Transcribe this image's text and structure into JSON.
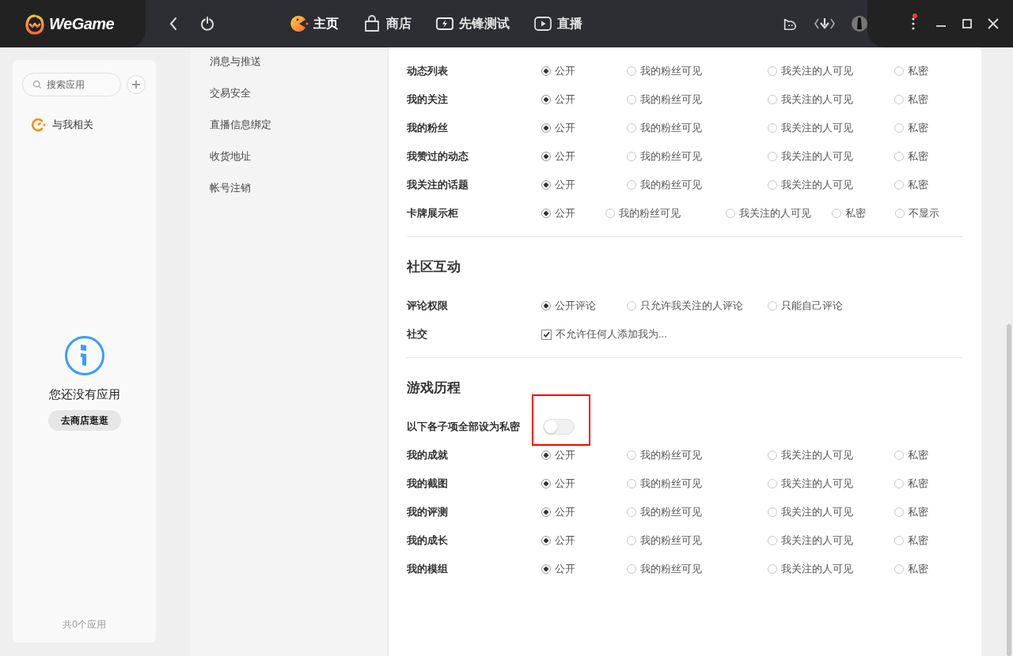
{
  "topbar": {
    "logo": "WeGame",
    "nav": [
      {
        "label": "主页",
        "selected": true
      },
      {
        "label": "商店",
        "selected": false
      },
      {
        "label": "先锋测试",
        "selected": false
      },
      {
        "label": "直播",
        "selected": false
      }
    ],
    "menu_notification": true
  },
  "sidebar": {
    "search": {
      "placeholder": "搜索应用"
    },
    "items": [
      {
        "label": "与我相关"
      }
    ],
    "empty_text": "您还没有应用",
    "store_button": "去商店逛逛",
    "footer": "共0个应用"
  },
  "settings_nav": {
    "items": [
      "消息与推送",
      "交易安全",
      "直播信息绑定",
      "收货地址",
      "帐号注销"
    ]
  },
  "sections": [
    {
      "rows": [
        {
          "label": "动态列表",
          "kind": "radio",
          "options": [
            {
              "label": "公开",
              "selected": true
            },
            {
              "label": "我的粉丝可见",
              "selected": false
            },
            {
              "label": "我关注的人可见",
              "selected": false
            },
            {
              "label": "私密",
              "selected": false
            }
          ]
        },
        {
          "label": "我的关注",
          "kind": "radio",
          "options": [
            {
              "label": "公开",
              "selected": true
            },
            {
              "label": "我的粉丝可见",
              "selected": false
            },
            {
              "label": "我关注的人可见",
              "selected": false
            },
            {
              "label": "私密",
              "selected": false
            }
          ]
        },
        {
          "label": "我的粉丝",
          "kind": "radio",
          "options": [
            {
              "label": "公开",
              "selected": true
            },
            {
              "label": "我的粉丝可见",
              "selected": false
            },
            {
              "label": "我关注的人可见",
              "selected": false
            },
            {
              "label": "私密",
              "selected": false
            }
          ]
        },
        {
          "label": "我赞过的动态",
          "kind": "radio",
          "options": [
            {
              "label": "公开",
              "selected": true
            },
            {
              "label": "我的粉丝可见",
              "selected": false
            },
            {
              "label": "我关注的人可见",
              "selected": false
            },
            {
              "label": "私密",
              "selected": false
            }
          ]
        },
        {
          "label": "我关注的话题",
          "kind": "radio",
          "options": [
            {
              "label": "公开",
              "selected": true
            },
            {
              "label": "我的粉丝可见",
              "selected": false
            },
            {
              "label": "我关注的人可见",
              "selected": false
            },
            {
              "label": "私密",
              "selected": false
            }
          ]
        },
        {
          "label": "卡牌展示柜",
          "kind": "radio",
          "options": [
            {
              "label": "公开",
              "selected": true
            },
            {
              "label": "我的粉丝可见",
              "selected": false
            },
            {
              "label": "我关注的人可见",
              "selected": false
            },
            {
              "label": "私密",
              "selected": false
            },
            {
              "label": "不显示",
              "selected": false
            }
          ]
        }
      ]
    },
    {
      "title": "社区互动",
      "rows": [
        {
          "label": "评论权限",
          "kind": "radio",
          "options": [
            {
              "label": "公开评论",
              "selected": true
            },
            {
              "label": "只允许我关注的人评论",
              "selected": false
            },
            {
              "label": "只能自己评论",
              "selected": false
            }
          ]
        },
        {
          "label": "社交",
          "kind": "checkbox",
          "options": [
            {
              "label": "不允许任何人添加我为...",
              "checked": true
            }
          ]
        }
      ]
    },
    {
      "title": "游戏历程",
      "rows": [
        {
          "label": "以下各子项全部设为私密",
          "kind": "toggle",
          "on": false
        },
        {
          "label": "我的成就",
          "kind": "radio",
          "options": [
            {
              "label": "公开",
              "selected": true
            },
            {
              "label": "我的粉丝可见",
              "selected": false
            },
            {
              "label": "我关注的人可见",
              "selected": false
            },
            {
              "label": "私密",
              "selected": false
            }
          ]
        },
        {
          "label": "我的截图",
          "kind": "radio",
          "options": [
            {
              "label": "公开",
              "selected": true
            },
            {
              "label": "我的粉丝可见",
              "selected": false
            },
            {
              "label": "我关注的人可见",
              "selected": false
            },
            {
              "label": "私密",
              "selected": false
            }
          ]
        },
        {
          "label": "我的评测",
          "kind": "radio",
          "options": [
            {
              "label": "公开",
              "selected": true
            },
            {
              "label": "我的粉丝可见",
              "selected": false
            },
            {
              "label": "我关注的人可见",
              "selected": false
            },
            {
              "label": "私密",
              "selected": false
            }
          ]
        },
        {
          "label": "我的成长",
          "kind": "radio",
          "options": [
            {
              "label": "公开",
              "selected": true
            },
            {
              "label": "我的粉丝可见",
              "selected": false
            },
            {
              "label": "我关注的人可见",
              "selected": false
            },
            {
              "label": "私密",
              "selected": false
            }
          ]
        },
        {
          "label": "我的模组",
          "kind": "radio",
          "options": [
            {
              "label": "公开",
              "selected": true
            },
            {
              "label": "我的粉丝可见",
              "selected": false
            },
            {
              "label": "我关注的人可见",
              "selected": false
            },
            {
              "label": "私密",
              "selected": false
            }
          ]
        }
      ]
    }
  ]
}
